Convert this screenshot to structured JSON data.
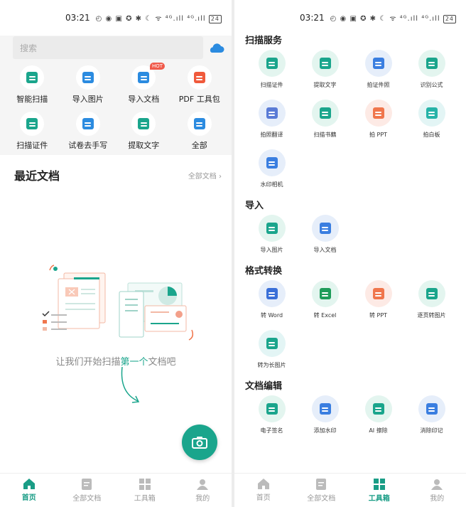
{
  "status": {
    "time": "03:21",
    "icons": "◴ ◉ ▣ ✪ ✱ ☾ ᯤ ⁴ᴳ.ıll ⁴ᴳ.ıll",
    "battery": "24"
  },
  "home": {
    "search_placeholder": "搜索",
    "quick_actions": [
      {
        "label": "智能扫描",
        "icon": "scan-frame-icon",
        "color": "#1aa58c"
      },
      {
        "label": "导入图片",
        "icon": "image-import-icon",
        "color": "#2b8be0"
      },
      {
        "label": "导入文档",
        "icon": "document-import-icon",
        "color": "#2b8be0",
        "badge": "HOT"
      },
      {
        "label": "PDF 工具包",
        "icon": "pdf-icon",
        "color": "#f05a3c"
      },
      {
        "label": "扫描证件",
        "icon": "id-card-icon",
        "color": "#1aa58c"
      },
      {
        "label": "试卷去手写",
        "icon": "exam-clean-icon",
        "color": "#2b8be0"
      },
      {
        "label": "提取文字",
        "icon": "text-extract-icon",
        "color": "#1aa58c"
      },
      {
        "label": "全部",
        "icon": "grid-all-icon",
        "color": "#2b8be0"
      }
    ],
    "recent_title": "最近文档",
    "recent_all": "全部文档",
    "empty_before": "让我们开始扫描",
    "empty_highlight": "第一个",
    "empty_after": "文档吧"
  },
  "tabs": [
    "首页",
    "全部文档",
    "工具箱",
    "我的"
  ],
  "toolbox": {
    "sections": [
      {
        "title": "扫描服务",
        "tools": [
          {
            "label": "扫描证件",
            "icon": "id-card-icon",
            "bg": "#e3f5ef",
            "color": "#1aa58c"
          },
          {
            "label": "提取文字",
            "icon": "text-extract-icon",
            "bg": "#e3f5ef",
            "color": "#1aa58c"
          },
          {
            "label": "拍证件照",
            "icon": "portrait-icon",
            "bg": "#e6eefa",
            "color": "#3a7ee0"
          },
          {
            "label": "识别公式",
            "icon": "formula-icon",
            "bg": "#e3f5ef",
            "color": "#1aa58c"
          },
          {
            "label": "拍照翻译",
            "icon": "translate-icon",
            "bg": "#e6eefa",
            "color": "#5a7bd6"
          },
          {
            "label": "扫描书籍",
            "icon": "book-icon",
            "bg": "#e3f5ef",
            "color": "#1aa58c"
          },
          {
            "label": "拍 PPT",
            "icon": "presentation-icon",
            "bg": "#fdeae5",
            "color": "#f0764c"
          },
          {
            "label": "拍白板",
            "icon": "whiteboard-icon",
            "bg": "#e3f5f5",
            "color": "#26b3a8"
          },
          {
            "label": "水印相机",
            "icon": "watermark-camera-icon",
            "bg": "#e6eefa",
            "color": "#3a7ee0"
          }
        ]
      },
      {
        "title": "导入",
        "tools": [
          {
            "label": "导入图片",
            "icon": "image-import-icon",
            "bg": "#e3f5ef",
            "color": "#1aa58c"
          },
          {
            "label": "导入文档",
            "icon": "document-import-icon",
            "bg": "#e6eefa",
            "color": "#3a7ee0"
          }
        ]
      },
      {
        "title": "格式转换",
        "tools": [
          {
            "label": "转 Word",
            "icon": "word-icon",
            "bg": "#e6eefa",
            "color": "#3a6fd8"
          },
          {
            "label": "转 Excel",
            "icon": "excel-icon",
            "bg": "#e3f5ef",
            "color": "#1e9c5a"
          },
          {
            "label": "转 PPT",
            "icon": "ppt-icon",
            "bg": "#fdeae5",
            "color": "#f0764c"
          },
          {
            "label": "逐页转图片",
            "icon": "page-image-icon",
            "bg": "#e3f5ef",
            "color": "#1aa58c"
          },
          {
            "label": "转为长图片",
            "icon": "long-image-icon",
            "bg": "#e3f5f5",
            "color": "#1aa58c"
          }
        ]
      },
      {
        "title": "文档编辑",
        "tools": [
          {
            "label": "电子签名",
            "icon": "signature-icon",
            "bg": "#e3f5ef",
            "color": "#1aa58c"
          },
          {
            "label": "添加水印",
            "icon": "stamp-icon",
            "bg": "#e6eefa",
            "color": "#3a7ee0"
          },
          {
            "label": "AI 擦除",
            "icon": "eraser-icon",
            "bg": "#e3f5ef",
            "color": "#1aa58c"
          },
          {
            "label": "消除印记",
            "icon": "remove-mark-icon",
            "bg": "#e6eefa",
            "color": "#3a7ee0"
          }
        ]
      }
    ]
  },
  "colors": {
    "accent": "#1aa58c",
    "tab_inactive": "#999999"
  }
}
